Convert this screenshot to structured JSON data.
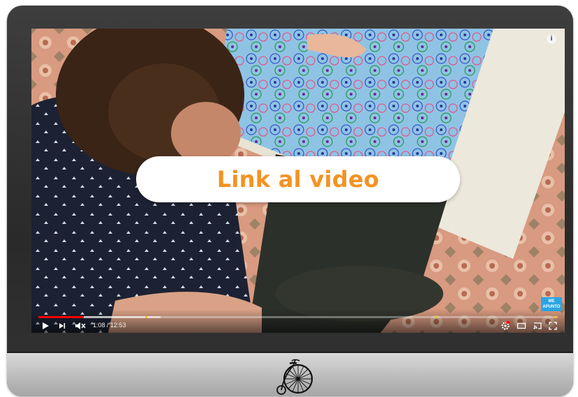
{
  "video": {
    "overlay_link_text": "Link al video",
    "info_icon": "info-icon",
    "badge_lines": [
      "ME",
      "APUNTO"
    ],
    "current_time": "1:08",
    "duration": "12:53",
    "time_display": "1:08 / 12:53",
    "played_fraction": 0.088,
    "buffered_fraction": 0.235,
    "chapter_marks": [
      0.205,
      0.765,
      0.993
    ]
  },
  "controls": {
    "play_icon": "play-icon",
    "next_icon": "next-icon",
    "mute_icon": "volume-muted-icon",
    "hd_icon": "settings-hd-icon",
    "theater_icon": "theater-mode-icon",
    "cast_icon": "cast-icon",
    "fullscreen_icon": "fullscreen-icon"
  },
  "monitor": {
    "logo": "penny-farthing-bicycle-icon"
  },
  "colors": {
    "link_text": "#f39323",
    "progress_played": "#ff0000",
    "chapter_mark": "#f5c518",
    "badge": "#2aa6e6"
  }
}
